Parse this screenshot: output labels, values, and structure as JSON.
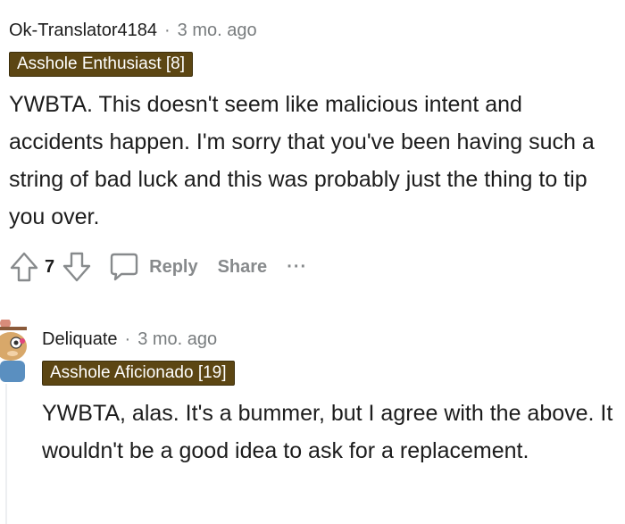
{
  "comment1": {
    "author": "Ok-Translator4184",
    "separator": "·",
    "time": "3 mo. ago",
    "flair": "Asshole Enthusiast [8]",
    "body": "YWBTA. This doesn't seem like malicious intent and accidents happen. I'm sorry that you've been having such a string of bad luck and this was probably just the thing to tip you over.",
    "score": "7",
    "reply_label": "Reply",
    "share_label": "Share",
    "more_label": "···"
  },
  "comment2": {
    "author": "Deliquate",
    "separator": "·",
    "time": "3 mo. ago",
    "flair": "Asshole Aficionado [19]",
    "body": "YWBTA, alas. It's a bummer, but I agree with the above. It wouldn't be a good idea to ask for a replacement."
  },
  "colors": {
    "flair_bg": "#5c4613",
    "meta_gray": "#787c7e",
    "action_gray": "#878a8c"
  },
  "icons": [
    "upvote-icon",
    "downvote-icon",
    "comment-icon",
    "more-icon",
    "avatar"
  ]
}
